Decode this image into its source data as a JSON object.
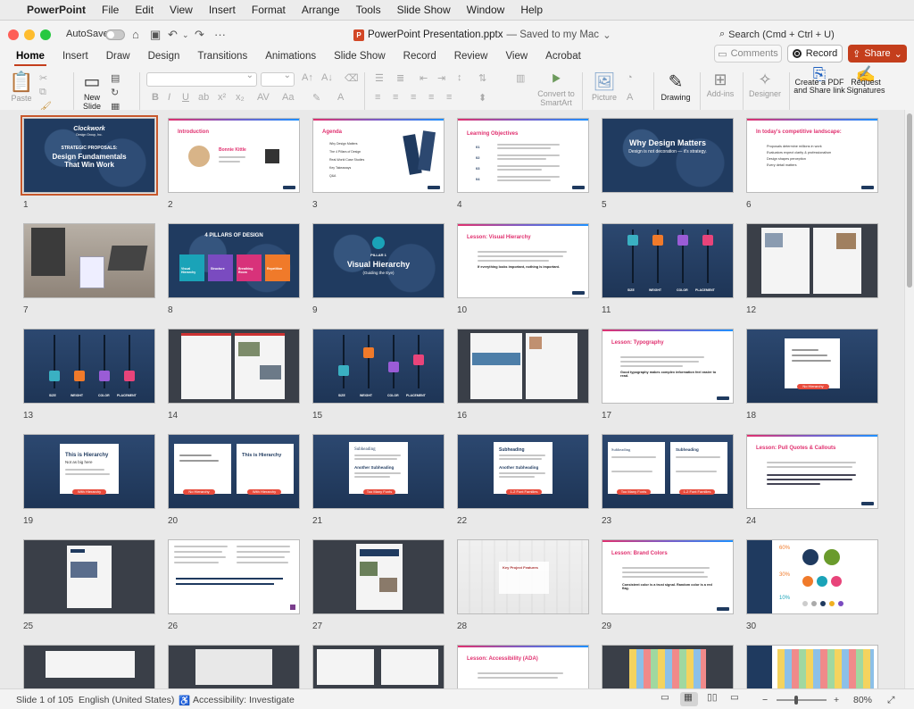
{
  "menubar": {
    "app": "PowerPoint",
    "items": [
      "File",
      "Edit",
      "View",
      "Insert",
      "Format",
      "Arrange",
      "Tools",
      "Slide Show",
      "Window",
      "Help"
    ]
  },
  "titlebar": {
    "autosave_label": "AutoSave",
    "doc_name": "PowerPoint Presentation.pptx",
    "saved_status": "— Saved to my Mac",
    "search_placeholder": "Search (Cmd + Ctrl + U)"
  },
  "tabs": [
    "Home",
    "Insert",
    "Draw",
    "Design",
    "Transitions",
    "Animations",
    "Slide Show",
    "Record",
    "Review",
    "View",
    "Acrobat"
  ],
  "active_tab": "Home",
  "right_buttons": {
    "comments": "Comments",
    "record": "Record",
    "share": "Share"
  },
  "ribbon": {
    "paste": "Paste",
    "new_slide": "New\nSlide",
    "convert_smartart": "Convert to SmartArt",
    "picture": "Picture",
    "drawing": "Drawing",
    "addins": "Add-ins",
    "designer": "Designer",
    "create_pdf": "Create a PDF and Share link",
    "request_sig": "Request Signatures"
  },
  "slides": [
    {
      "n": "1"
    },
    {
      "n": "2"
    },
    {
      "n": "3"
    },
    {
      "n": "4"
    },
    {
      "n": "5"
    },
    {
      "n": "6"
    },
    {
      "n": "7"
    },
    {
      "n": "8"
    },
    {
      "n": "9"
    },
    {
      "n": "10"
    },
    {
      "n": "11"
    },
    {
      "n": "12"
    },
    {
      "n": "13"
    },
    {
      "n": "14"
    },
    {
      "n": "15"
    },
    {
      "n": "16"
    },
    {
      "n": "17"
    },
    {
      "n": "18"
    },
    {
      "n": "19"
    },
    {
      "n": "20"
    },
    {
      "n": "21"
    },
    {
      "n": "22"
    },
    {
      "n": "23"
    },
    {
      "n": "24"
    },
    {
      "n": "25"
    },
    {
      "n": "26"
    },
    {
      "n": "27"
    },
    {
      "n": "28"
    },
    {
      "n": "29"
    },
    {
      "n": "30"
    }
  ],
  "slide_text": {
    "s1_brand": "Clockwork",
    "s1_sub": "Design Group, Inc.",
    "s1_kicker": "STRATEGIC PROPOSALS:",
    "s1_title": "Design Fundamentals That Win Work",
    "s2_title": "Introduction",
    "s2_name": "Bonnie Kittle",
    "s3_title": "Agenda",
    "s3_items": [
      "Why Design Matters",
      "The 4 Pillars of Design",
      "Real-World Case Studies",
      "Key Takeaways",
      "Q&A"
    ],
    "s4_title": "Learning Objectives",
    "s4_nums": [
      "01",
      "02",
      "03",
      "04"
    ],
    "s5_title": "Why Design Matters",
    "s5_sub": "Design is not decoration — it's strategy.",
    "s6_title": "In today's competitive landscape:",
    "s6_items": [
      "Proposals determine millions in work",
      "Evaluators expect clarity & professionalism",
      "Design shapes perception",
      "Every detail matters"
    ],
    "s8_title": "4 PILLARS OF DESIGN",
    "s8_pillars": [
      "Visual Hierarchy",
      "Structure",
      "Breathing Room",
      "Repetition"
    ],
    "s9_kicker": "PILLAR 1",
    "s9_title": "Visual Hierarchy",
    "s9_sub": "(Guiding the Eye)",
    "s10_title": "Lesson: Visual Hierarchy",
    "s10_bold": "If everything looks important, nothing is important.",
    "slider_labels": [
      "SIZE",
      "WEIGHT",
      "COLOR",
      "PLACEMENT"
    ],
    "s17_title": "Lesson: Typography",
    "s17_bold": "Good typography makes complex information feel easier to read.",
    "s18_pill": "No Hierarchy",
    "s19_title": "This is Hierarchy",
    "s19_sub": "Not as big here",
    "s19_pill": "With Hierarchy",
    "s20_pill_a": "No Hierarchy",
    "s20_pill_b": "With Hierarchy",
    "s21_head": "Subheading",
    "s21_head2": "Another Subheading",
    "s21_pill": "Too Many Fonts",
    "s22_pill": "1-2 Font Families",
    "s23_pill_a": "Too Many Fonts",
    "s23_pill_b": "1-2 Font Families",
    "s24_title": "Lesson: Pull Quotes & Callouts",
    "s28_title": "Key Project Features",
    "s29_title": "Lesson: Brand Colors",
    "s29_bold": "Consistent color is a trust signal. Random color is a red flag.",
    "s30_pcts": [
      "60%",
      "30%",
      "10%"
    ],
    "s33_title": "Lesson: Accessibility (ADA)"
  },
  "status": {
    "slide_count": "Slide 1 of 105",
    "language": "English (United States)",
    "accessibility": "Accessibility: Investigate",
    "zoom": "80%"
  },
  "colors": {
    "accent": "#c43e1c",
    "navy": "#1f3a5f",
    "pink": "#e0306f"
  }
}
